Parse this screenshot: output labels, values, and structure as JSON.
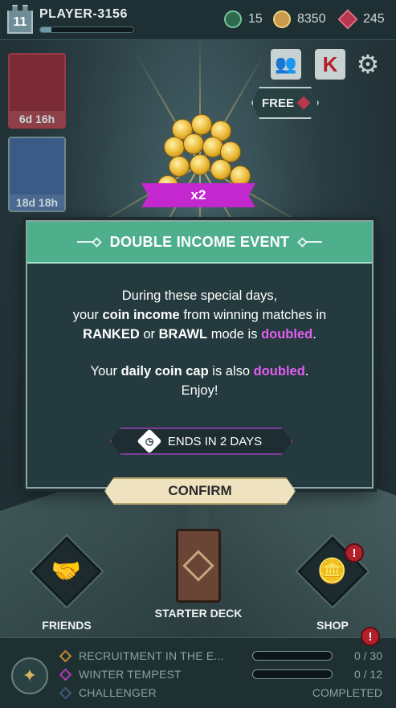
{
  "player": {
    "level": "11",
    "name": "PLAYER-3156",
    "xp_fraction": 0.12
  },
  "currencies": [
    {
      "icon": "token-icon",
      "value": "15"
    },
    {
      "icon": "coin-icon",
      "value": "8350"
    },
    {
      "icon": "gem-icon",
      "value": "245"
    }
  ],
  "side_items": [
    {
      "label": "6d 16h"
    },
    {
      "label": "18d 18h"
    }
  ],
  "free_badge": {
    "label": "FREE"
  },
  "multiplier": "x2",
  "modal": {
    "title": "DOUBLE INCOME EVENT",
    "p1_a": "During these special days,",
    "p1_b": "your ",
    "p1_c": "coin income",
    "p1_d": " from winning matches in",
    "p1_e": "RANKED",
    "p1_f": " or ",
    "p1_g": "BRAWL",
    "p1_h": " mode is ",
    "p1_i": "doubled",
    "p1_j": ".",
    "p2_a": "Your ",
    "p2_b": "daily coin cap",
    "p2_c": " is also ",
    "p2_d": "doubled",
    "p2_e": ".",
    "p2_f": "Enjoy!",
    "ends_label": "ENDS IN 2 DAYS",
    "confirm_label": "CONFIRM"
  },
  "nav": {
    "friends": "FRIENDS",
    "starter_deck": "STARTER DECK",
    "shop": "SHOP",
    "shop_alert": "!"
  },
  "quests": {
    "alert": "!",
    "items": [
      {
        "name": "RECRUITMENT IN THE E...",
        "count": "0 / 30",
        "color": "#c7892c"
      },
      {
        "name": "WINTER TEMPEST",
        "count": "0 / 12",
        "color": "#b03ab8"
      },
      {
        "name": "CHALLENGER",
        "count": "COMPLETED",
        "color": "#3e5a7a"
      }
    ]
  },
  "colors": {
    "header_green": "#4fae8c",
    "highlight_magenta": "#e25ef0",
    "confirm_bg": "#efe2bf"
  }
}
